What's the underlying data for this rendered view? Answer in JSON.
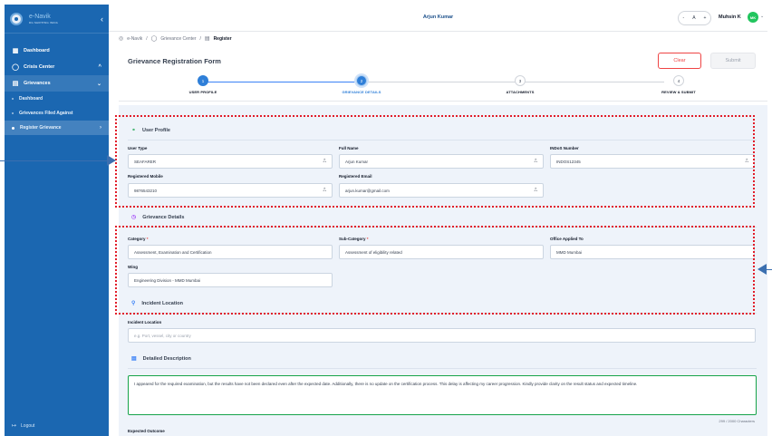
{
  "sidebar": {
    "brand_name": "e-Navik",
    "brand_sub": "DG SHIPPING INDIA",
    "collapse_icon": "chevron-left",
    "items": [
      {
        "label": "Dashboard",
        "icon": "grid-icon"
      },
      {
        "label": "Crisis Center",
        "icon": "circle-icon",
        "chevron": "^"
      },
      {
        "label": "Grievances",
        "icon": "document-icon",
        "chevron": "v"
      }
    ],
    "sub_items": [
      {
        "label": "Dashboard"
      },
      {
        "label": "Grievances Filed Against"
      },
      {
        "label": "Register Grievance",
        "chevron": ">"
      }
    ],
    "logout_label": "Logout",
    "color": "#1b67b1"
  },
  "topbar": {
    "title": "Arjun Kumar",
    "font_minus": "-",
    "font_a": "A",
    "font_plus": "+",
    "user_name": "Muhsin K",
    "avatar_initials": "MK",
    "avatar_color": "#22c55e"
  },
  "breadcrumb": {
    "home": "e-Navik",
    "sep": "/",
    "center": "Grievance Center",
    "current": "Register"
  },
  "header": {
    "title": "Grievance Registration Form",
    "clear_label": "Clear",
    "submit_label": "Submit"
  },
  "steps": [
    {
      "num": "1",
      "label": "USER PROFILE"
    },
    {
      "num": "2",
      "label": "GRIEVANCE DETAILS"
    },
    {
      "num": "3",
      "label": "ATTACHMENTS"
    },
    {
      "num": "4",
      "label": "REVIEW & SUBMIT"
    }
  ],
  "user_profile": {
    "heading": "User Profile",
    "user_type_label": "User Type",
    "user_type": "SEAFARER",
    "full_name_label": "Full Name",
    "full_name": "Arjun Kumar",
    "indos_label": "INDoS Number",
    "indos": "INDOS12345",
    "mobile_label": "Registered Mobile",
    "mobile": "9876543210",
    "email_label": "Registered Email",
    "email": "arjun.kumar@gmail.com"
  },
  "grievance_details": {
    "heading": "Grievance Details",
    "category_label": "Category",
    "category": "Assessment, Examination and Certification",
    "subcategory_label": "Sub-Category",
    "subcategory": "Assessment of eligibility related",
    "office_label": "Office Applied To",
    "office": "MMD Mumbai",
    "wing_label": "Wing",
    "wing": "Engineering Division - MMD Mumbai",
    "required_mark": "*"
  },
  "incident": {
    "heading": "Incident Location",
    "label": "Incident Location",
    "placeholder": "e.g. Port, vessel, city or country"
  },
  "description": {
    "heading": "Detailed Description",
    "text": "I appeared for the required examination, but the results have not been declared even after the expected date. Additionally, there is no update on the certification process. This delay is affecting my career progression. Kindly provide clarity on the result status and expected timeline.",
    "counter": "299 / 2000 Characters"
  },
  "expected_outcome_label": "Expected Outcome",
  "annotations": {
    "box_color": "#e11d2a",
    "arrow_color": "#3b6fb0"
  }
}
